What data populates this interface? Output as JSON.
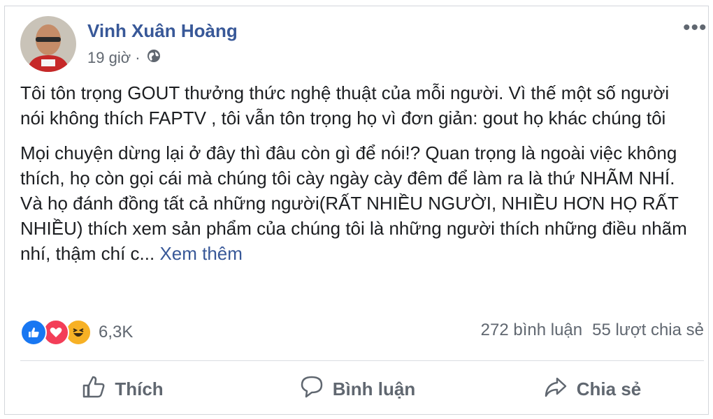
{
  "post": {
    "author": "Vinh Xuân Hoàng",
    "time": "19 giờ ·",
    "privacy_icon": "globe-icon",
    "more_label": "•••",
    "paragraphs": [
      "Tôi tôn trọng GOUT thưởng thức nghệ thuật của mỗi người. Vì thế một số người nói không thích FAPTV , tôi vẫn tôn trọng họ vì đơn giản: gout họ khác chúng tôi",
      "Mọi chuyện dừng lại ở đây thì đâu còn gì để nói!? Quan trọng là ngoài việc không thích, họ còn gọi cái mà chúng tôi cày ngày cày đêm để làm ra là thứ NHÃM NHÍ. Và họ đánh đồng tất cả những người(RẤT NHIỀU NGƯỜI, NHIỀU HƠN HỌ RẤT NHIỀU) thích xem sản phẩm của chúng tôi là những người thích những điều nhãm nhí, thậm chí c..."
    ],
    "see_more": "Xem thêm"
  },
  "reactions": {
    "icons": [
      "like-icon",
      "love-icon",
      "haha-icon"
    ],
    "count": "6,3K",
    "comments": "272 bình luận",
    "shares": "55 lượt chia sẻ"
  },
  "actions": {
    "like": "Thích",
    "comment": "Bình luận",
    "share": "Chia sẻ"
  },
  "colors": {
    "author": "#385898",
    "like": "#1877f2",
    "love": "#f33e58",
    "haha": "#f7b125"
  }
}
